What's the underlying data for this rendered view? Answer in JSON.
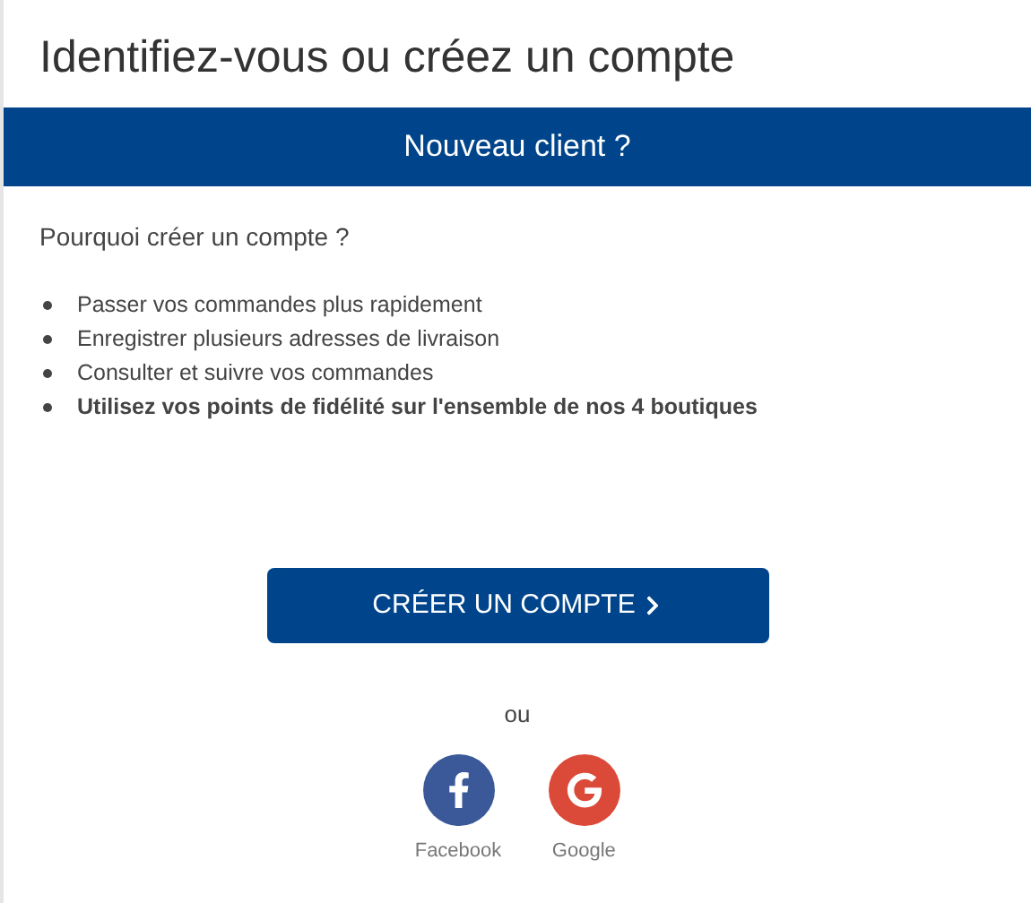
{
  "title": "Identifiez-vous ou créez un compte",
  "banner": "Nouveau client ?",
  "question": "Pourquoi créer un compte ?",
  "benefits": [
    {
      "text": "Passer vos commandes plus rapidement",
      "bold": false
    },
    {
      "text": "Enregistrer plusieurs adresses de livraison",
      "bold": false
    },
    {
      "text": "Consulter et suivre vos commandes",
      "bold": false
    },
    {
      "text": "Utilisez vos points de fidélité sur l'ensemble de nos 4 boutiques",
      "bold": true
    }
  ],
  "create_button": "CRÉER UN COMPTE",
  "separator": "ou",
  "social": [
    {
      "kind": "facebook",
      "label": "Facebook"
    },
    {
      "kind": "google",
      "label": "Google"
    }
  ]
}
